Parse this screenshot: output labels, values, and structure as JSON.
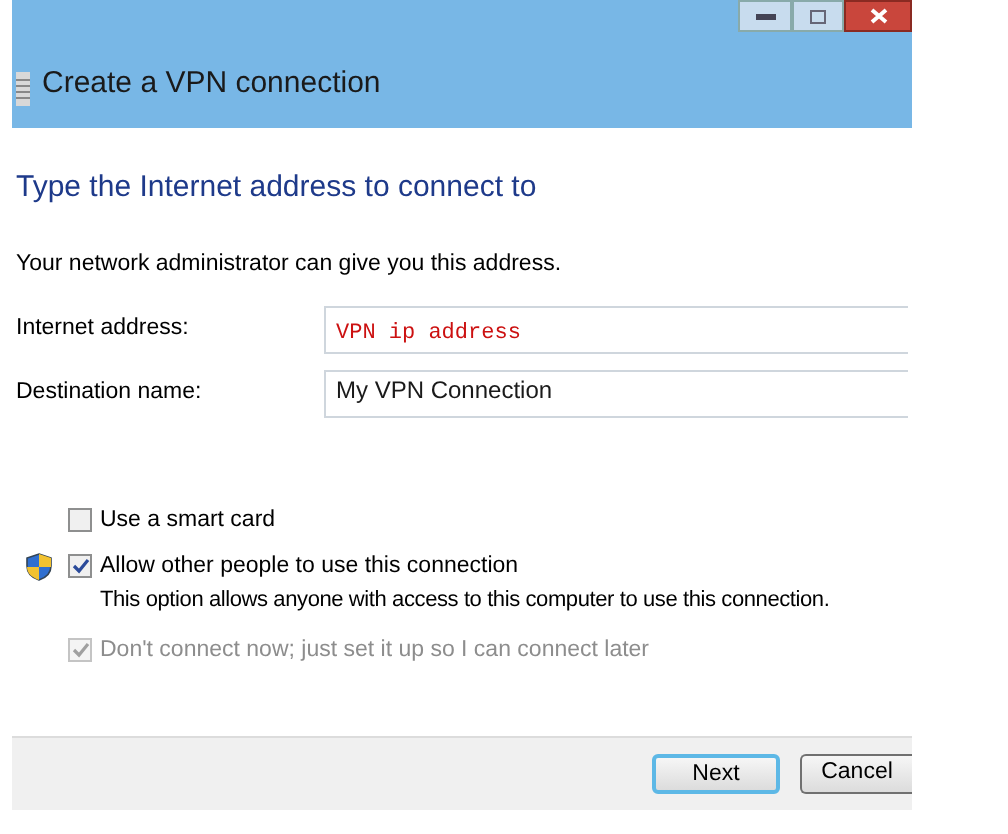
{
  "window": {
    "title": "Create a VPN connection"
  },
  "heading": "Type the Internet address to connect to",
  "intro": "Your network administrator can give you this address.",
  "fields": [
    {
      "label": "Internet address:",
      "value": "VPN ip address",
      "kind": "annotation"
    },
    {
      "label": "Destination name:",
      "value": "My VPN Connection",
      "kind": "plain"
    }
  ],
  "options": [
    {
      "label": "Use a smart card",
      "checked": false,
      "disabled": false,
      "kind": "plain"
    },
    {
      "label": "Allow other people to use this connection",
      "description": "This option allows anyone with access to this computer to use this connection.",
      "checked": true,
      "disabled": false,
      "kind": "shielded"
    },
    {
      "label": "Don't connect now; just set it up so I can connect later",
      "checked": true,
      "disabled": true,
      "kind": "plain"
    }
  ],
  "buttons": [
    {
      "label": "Next",
      "selected": true
    },
    {
      "label": "Cancel",
      "selected": false
    }
  ]
}
